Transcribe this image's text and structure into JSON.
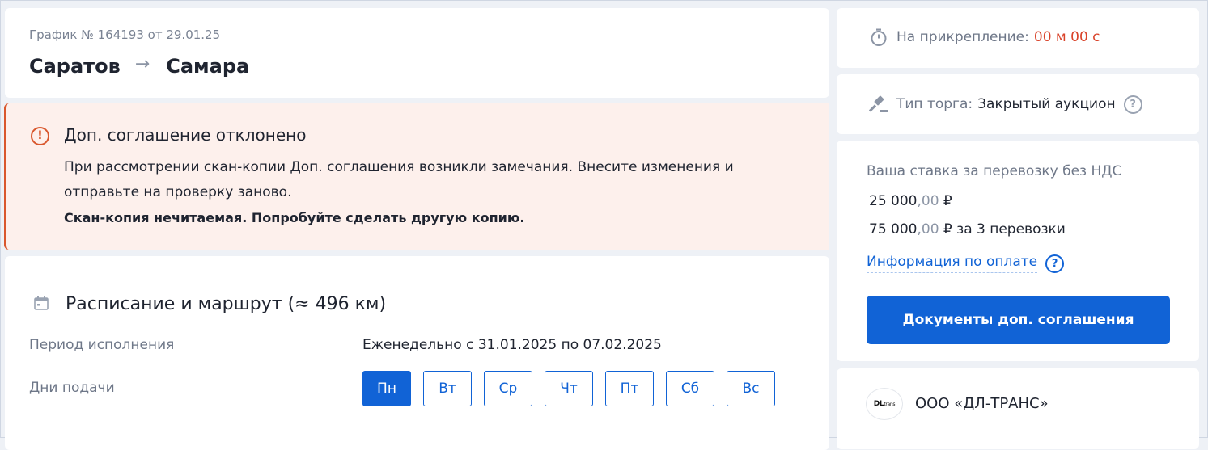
{
  "header": {
    "subtitle": "График № 164193 от 29.01.25",
    "from": "Саратов",
    "arrow": "→",
    "to": "Самара"
  },
  "alert": {
    "icon": "exclamation-circle-icon",
    "icon_glyph": "!",
    "title": "Доп. соглашение отклонено",
    "body": "При рассмотрении скан-копии Доп. соглашения возникли замечания. Внесите изменения и отправьте на проверку заново.",
    "strong": "Скан-копия нечитаемая. Попробуйте сделать другую копию.",
    "color": "#d9572d",
    "background": "#fdf0ec"
  },
  "schedule": {
    "title": "Расписание и маршрут (≈ 496 км)",
    "period_label": "Период исполнения",
    "period_value": "Еженедельно с 31.01.2025 по 07.02.2025",
    "days_label": "Дни подачи",
    "days": [
      {
        "label": "Пн",
        "selected": true
      },
      {
        "label": "Вт",
        "selected": false
      },
      {
        "label": "Ср",
        "selected": false
      },
      {
        "label": "Чт",
        "selected": false
      },
      {
        "label": "Пт",
        "selected": false
      },
      {
        "label": "Сб",
        "selected": false
      },
      {
        "label": "Вс",
        "selected": false
      }
    ]
  },
  "timer": {
    "icon": "stopwatch-icon",
    "label": "На прикрепление:",
    "value": "00 м 00 с",
    "value_color": "#d9432a"
  },
  "trade": {
    "icon": "gavel-icon",
    "label": "Тип торга:",
    "value": "Закрытый аукцион",
    "help_glyph": "?"
  },
  "rate": {
    "title": "Ваша ставка за перевозку без НДС",
    "single_main": "25 000",
    "single_cents": ",00",
    "single_currency": " ₽",
    "total_main": "75 000",
    "total_cents": ",00",
    "total_suffix": " ₽ за 3 перевозки",
    "payment_link": "Информация по оплате",
    "help_glyph": "?",
    "documents_button": "Документы доп. соглашения",
    "accent": "#1163d6"
  },
  "company": {
    "logo_text": "DL",
    "logo_sup": "trans",
    "name": "ООО «ДЛ-ТРАНС»"
  }
}
